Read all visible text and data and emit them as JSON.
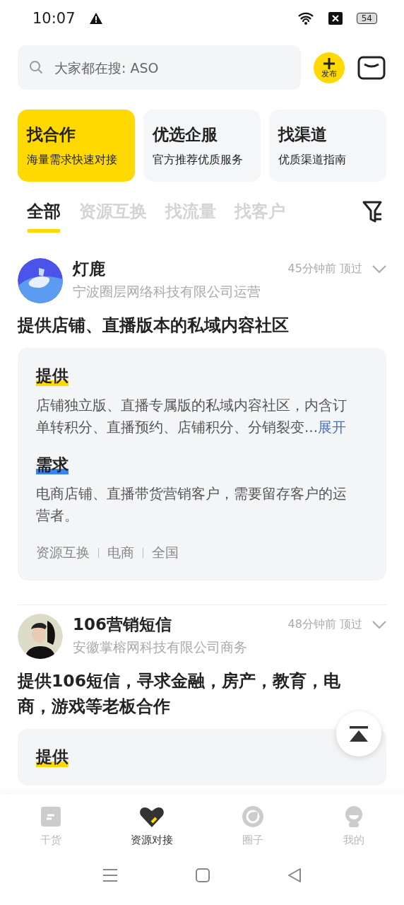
{
  "status_bar": {
    "time": "10:07",
    "battery": "54"
  },
  "search": {
    "placeholder": "大家都在搜: ASO"
  },
  "publish_button": {
    "label": "发布"
  },
  "categories": [
    {
      "title": "找合作",
      "subtitle": "海量需求快速对接",
      "selected": true
    },
    {
      "title": "优选企服",
      "subtitle": "官方推荐优质服务",
      "selected": false
    },
    {
      "title": "找渠道",
      "subtitle": "优质渠道指南",
      "selected": false
    }
  ],
  "tabs": [
    {
      "label": "全部",
      "selected": true
    },
    {
      "label": "资源互换",
      "selected": false
    },
    {
      "label": "找流量",
      "selected": false
    },
    {
      "label": "找客户",
      "selected": false
    }
  ],
  "posts": [
    {
      "author": "灯鹿",
      "company": "宁波圈层网络科技有限公司运营",
      "time": "45分钟前",
      "action": "顶过",
      "title": "提供店铺、直播版本的私域内容社区",
      "sections": [
        {
          "kind": "offer",
          "heading": "提供",
          "text": "店铺独立版、直播专属版的私域内容社区，内含订单转积分、直播预约、店铺积分、分销裂变...",
          "more": "展开"
        },
        {
          "kind": "demand",
          "heading": "需求",
          "text": "电商店铺、直播带货营销客户，需要留存客户的运营者。"
        }
      ],
      "tags": [
        "资源互换",
        "电商",
        "全国"
      ]
    },
    {
      "author": "106营销短信",
      "company": "安徽掌榕网科技有限公司商务",
      "time": "48分钟前",
      "action": "顶过",
      "title": "提供106短信，寻求金融，房产，教育，电商，游戏等老板合作",
      "sections": [
        {
          "kind": "offer",
          "heading": "提供"
        }
      ]
    }
  ],
  "bottom_nav": [
    {
      "label": "干货",
      "selected": false
    },
    {
      "label": "资源对接",
      "selected": true
    },
    {
      "label": "圈子",
      "selected": false
    },
    {
      "label": "我的",
      "selected": false
    }
  ]
}
